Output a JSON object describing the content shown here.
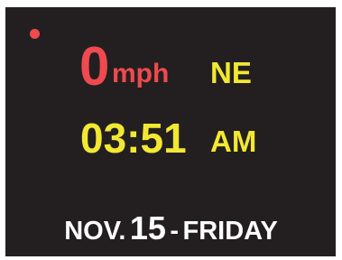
{
  "speed": {
    "value": "0",
    "unit": "mph"
  },
  "heading": "NE",
  "clock": {
    "time": "03:51",
    "period": "AM"
  },
  "date": {
    "month": "NOV.",
    "day": "15",
    "separator": "-",
    "weekday": "FRIDAY"
  },
  "colors": {
    "background": "#231f20",
    "speed": "#ee4a4f",
    "indicator": "#ee4a4f",
    "accent": "#f2e831",
    "date": "#ffffff"
  }
}
